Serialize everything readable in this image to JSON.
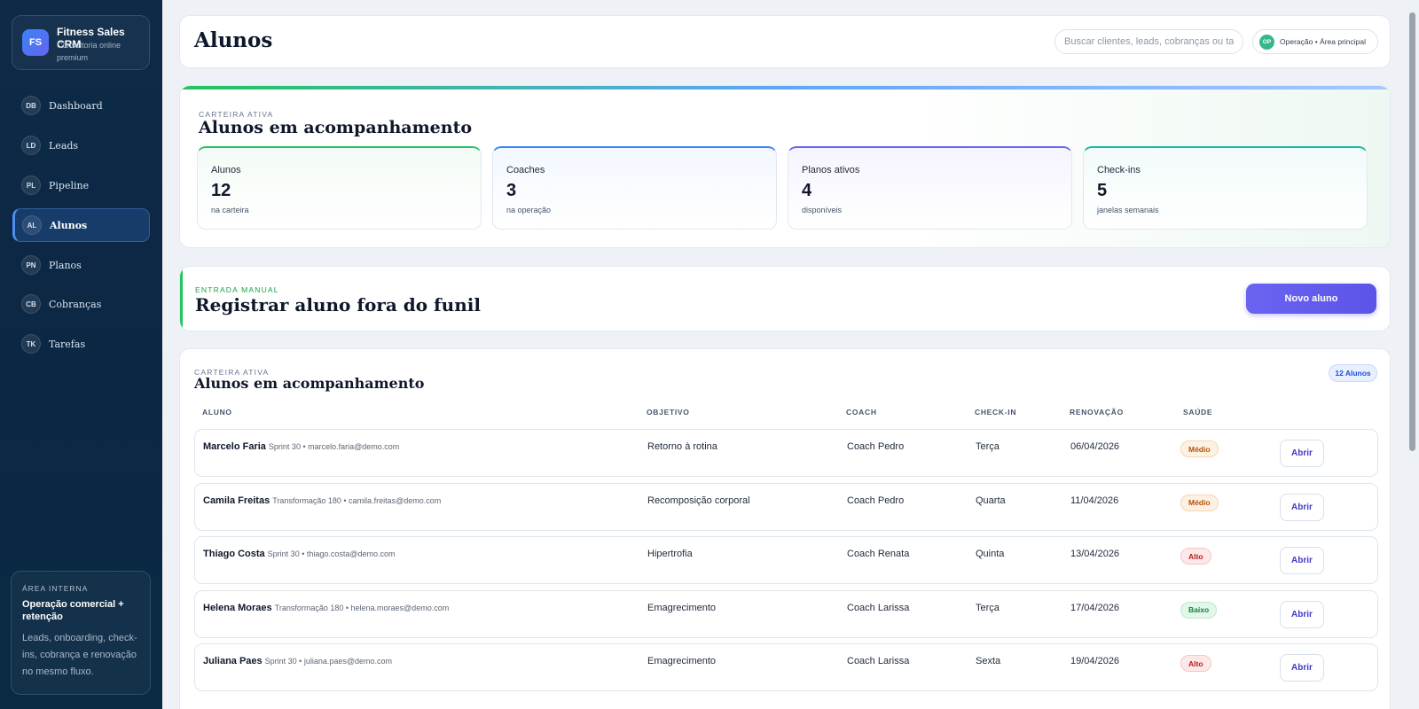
{
  "brand": {
    "initials": "FS",
    "name": "Fitness Sales CRM",
    "subtitle": "Consultoria online premium"
  },
  "nav": [
    {
      "badge": "DB",
      "label": "Dashboard"
    },
    {
      "badge": "LD",
      "label": "Leads"
    },
    {
      "badge": "PL",
      "label": "Pipeline"
    },
    {
      "badge": "AL",
      "label": "Alunos",
      "active": true
    },
    {
      "badge": "PN",
      "label": "Planos"
    },
    {
      "badge": "CB",
      "label": "Cobranças"
    },
    {
      "badge": "TK",
      "label": "Tarefas"
    }
  ],
  "area": {
    "kicker": "ÁREA INTERNA",
    "title": "Operação comercial + retenção",
    "description": "Leads, onboarding, check-ins, cobrança e renovação no mesmo fluxo."
  },
  "header": {
    "title": "Alunos",
    "search_placeholder": "Buscar clientes, leads, cobranças ou tarefas",
    "user_initials": "OP",
    "user_label": "Operação • Área principal"
  },
  "hero": {
    "kicker": "CARTEIRA ATIVA",
    "title": "Alunos em acompanhamento",
    "stats": [
      {
        "label": "Alunos",
        "value": "12",
        "sub": "na carteira",
        "accent": "#22c55e",
        "tint": "#f3fbf6"
      },
      {
        "label": "Coaches",
        "value": "3",
        "sub": "na operação",
        "accent": "#3b82f6",
        "tint": "#f3f7ff"
      },
      {
        "label": "Planos ativos",
        "value": "4",
        "sub": "disponíveis",
        "accent": "#6366f1",
        "tint": "#f6f4ff"
      },
      {
        "label": "Check-ins",
        "value": "5",
        "sub": "janelas semanais",
        "accent": "#14b8a6",
        "tint": "#f2fbfa"
      }
    ]
  },
  "entry": {
    "kicker": "ENTRADA MANUAL",
    "title": "Registrar aluno fora do funil",
    "button": "Novo aluno"
  },
  "list": {
    "kicker": "CARTEIRA ATIVA",
    "title": "Alunos em acompanhamento",
    "count": "12 Alunos",
    "columns": [
      "ALUNO",
      "OBJETIVO",
      "COACH",
      "CHECK-IN",
      "RENOVAÇÃO",
      "SAÚDE"
    ],
    "open_label": "Abrir",
    "rows": [
      {
        "name": "Marcelo Faria",
        "meta": "Sprint 30 • marcelo.faria@demo.com",
        "goal": "Retorno à rotina",
        "coach": "Coach Pedro",
        "checkin": "Terça",
        "renewal": "06/04/2026",
        "health": "Médio",
        "level": "medio"
      },
      {
        "name": "Camila Freitas",
        "meta": "Transformação 180 • camila.freitas@demo.com",
        "goal": "Recomposição corporal",
        "coach": "Coach Pedro",
        "checkin": "Quarta",
        "renewal": "11/04/2026",
        "health": "Médio",
        "level": "medio"
      },
      {
        "name": "Thiago Costa",
        "meta": "Sprint 30 • thiago.costa@demo.com",
        "goal": "Hipertrofia",
        "coach": "Coach Renata",
        "checkin": "Quinta",
        "renewal": "13/04/2026",
        "health": "Alto",
        "level": "alto"
      },
      {
        "name": "Helena Moraes",
        "meta": "Transformação 180 • helena.moraes@demo.com",
        "goal": "Emagrecimento",
        "coach": "Coach Larissa",
        "checkin": "Terça",
        "renewal": "17/04/2026",
        "health": "Baixo",
        "level": "baixo"
      },
      {
        "name": "Juliana Paes",
        "meta": "Sprint 30 • juliana.paes@demo.com",
        "goal": "Emagrecimento",
        "coach": "Coach Larissa",
        "checkin": "Sexta",
        "renewal": "19/04/2026",
        "health": "Alto",
        "level": "alto"
      }
    ]
  }
}
